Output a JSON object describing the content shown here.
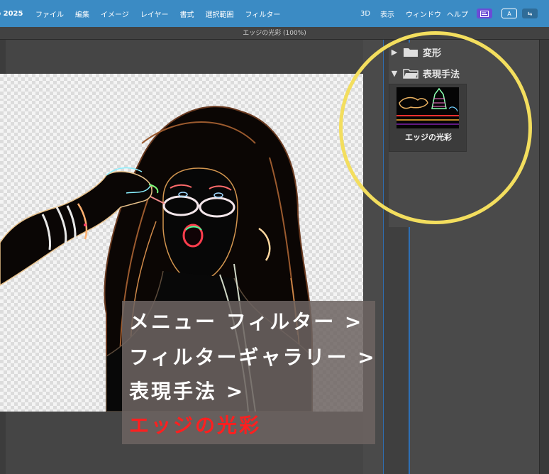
{
  "menubar": {
    "app_title": "p 2025",
    "items": [
      "ファイル",
      "編集",
      "イメージ",
      "レイヤー",
      "書式",
      "選択範囲",
      "フィルター"
    ],
    "right_items": [
      "3D",
      "表示",
      "ウィンドウ",
      "ヘルプ"
    ],
    "icon_a_label": "A",
    "icon_b_label": "⇆",
    "bar_color": "#3b8bc4"
  },
  "document": {
    "title": "エッジの光彩 (100%)"
  },
  "filter_gallery": {
    "folders": [
      {
        "label": "変形",
        "expanded": false
      },
      {
        "label": "表現手法",
        "expanded": true
      }
    ],
    "selected_filter": "エッジの光彩"
  },
  "overlay": {
    "line1": "メニュー  フィルター >",
    "line2": "フィルターギャラリー >",
    "line3": "表現手法 >",
    "line4": "エッジの光彩",
    "highlight_color": "#ff1f1f"
  },
  "annotation": {
    "circle_color": "#f3de5e"
  }
}
